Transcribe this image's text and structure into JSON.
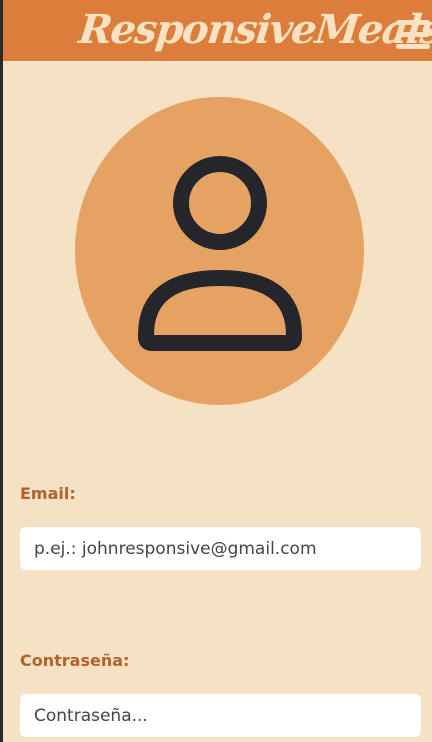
{
  "header": {
    "brand": "ResponsiveMeals",
    "menu_icon": "hamburger-menu-icon"
  },
  "profile": {
    "avatar_icon": "user-profile-icon"
  },
  "form": {
    "email_label": "Email:",
    "email_placeholder": "p.ej.: johnresponsive@gmail.com",
    "password_label": "Contraseña:",
    "password_placeholder": "Contraseña..."
  },
  "colors": {
    "header_bg": "#dd7d3c",
    "page_bg": "#f5e1c4",
    "avatar_bg": "#e5a262",
    "label": "#b3622c",
    "icon_stroke": "#24262b"
  }
}
